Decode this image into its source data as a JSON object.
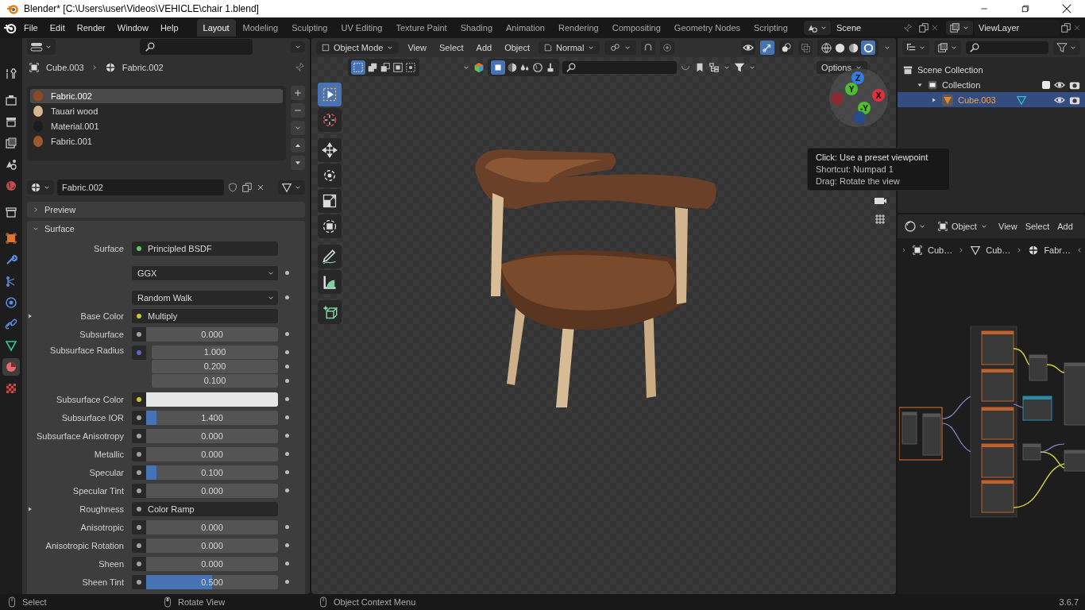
{
  "window": {
    "title": "Blender* [C:\\Users\\user\\Videos\\VEHICLE\\chair 1.blend]"
  },
  "menu": [
    "File",
    "Edit",
    "Render",
    "Window",
    "Help"
  ],
  "workspaces": [
    {
      "label": "Layout",
      "selected": true
    },
    {
      "label": "Modeling",
      "selected": false
    },
    {
      "label": "Sculpting",
      "selected": false
    },
    {
      "label": "UV Editing",
      "selected": false
    },
    {
      "label": "Texture Paint",
      "selected": false
    },
    {
      "label": "Shading",
      "selected": false
    },
    {
      "label": "Animation",
      "selected": false
    },
    {
      "label": "Rendering",
      "selected": false
    },
    {
      "label": "Compositing",
      "selected": false
    },
    {
      "label": "Geometry Nodes",
      "selected": false
    },
    {
      "label": "Scripting",
      "selected": false
    }
  ],
  "scene": "Scene",
  "view_layer": "ViewLayer",
  "properties": {
    "tabs": [
      {
        "kind": "tool",
        "selected": false
      },
      {
        "kind": "render",
        "selected": false
      },
      {
        "kind": "output",
        "selected": false
      },
      {
        "kind": "view-layer",
        "selected": false
      },
      {
        "kind": "scene",
        "selected": false
      },
      {
        "kind": "world",
        "selected": false
      },
      {
        "kind": "collection",
        "selected": false
      },
      {
        "kind": "object",
        "selected": false
      },
      {
        "kind": "modifier",
        "selected": false
      },
      {
        "kind": "particles",
        "selected": false
      },
      {
        "kind": "physics",
        "selected": false
      },
      {
        "kind": "constraints",
        "selected": false
      },
      {
        "kind": "data",
        "selected": false
      },
      {
        "kind": "material",
        "selected": true
      },
      {
        "kind": "texture",
        "selected": false
      }
    ],
    "breadcrumb": [
      "Cube.003",
      "Fabric.002"
    ],
    "material_slots": [
      {
        "name": "Fabric.002",
        "color": "#8a4a24",
        "selected": true
      },
      {
        "name": "Tauari wood",
        "color": "#d8b88e",
        "selected": false
      },
      {
        "name": "Material.001",
        "color": "#1c1c1c",
        "selected": false
      },
      {
        "name": "Fabric.001",
        "color": "#9a5a2a",
        "selected": false
      }
    ],
    "material_name": "Fabric.002",
    "panels": [
      {
        "title": "Preview",
        "expanded": false
      },
      {
        "title": "Surface",
        "expanded": true
      }
    ],
    "rows": [
      {
        "kind": "link",
        "label": "Surface",
        "color": "#63c763",
        "value": "Principled BSDF",
        "expander": false
      },
      {
        "kind": "dropdown",
        "value": "GGX"
      },
      {
        "kind": "dropdown",
        "value": "Random Walk"
      },
      {
        "kind": "link",
        "label": "Base Color",
        "color": "#c7c729",
        "value": "Multiply",
        "expander": true
      },
      {
        "kind": "slider",
        "label": "Subsurface",
        "color": "#a1a1a1",
        "value": "0.000",
        "level": 0
      },
      {
        "kind": "vector",
        "label": "Subsurface Radius",
        "color": "#6363c7",
        "values": [
          "1.000",
          "0.200",
          "0.100"
        ]
      },
      {
        "kind": "swatch",
        "label": "Subsurface Color",
        "color": "#c7c729",
        "swatch": {
          "color": "#e6e6e6"
        }
      },
      {
        "kind": "slider",
        "label": "Subsurface IOR",
        "color": "#a1a1a1",
        "value": "1.400",
        "level": 0.08
      },
      {
        "kind": "slider",
        "label": "Subsurface Anisotropy",
        "color": "#a1a1a1",
        "value": "0.000",
        "level": 0
      },
      {
        "kind": "slider",
        "label": "Metallic",
        "color": "#a1a1a1",
        "value": "0.000",
        "level": 0
      },
      {
        "kind": "slider",
        "label": "Specular",
        "color": "#a1a1a1",
        "value": "0.100",
        "level": 0.08
      },
      {
        "kind": "slider",
        "label": "Specular Tint",
        "color": "#a1a1a1",
        "value": "0.000",
        "level": 0
      },
      {
        "kind": "link",
        "label": "Roughness",
        "color": "#a1a1a1",
        "value": "Color Ramp",
        "expander": true
      },
      {
        "kind": "slider",
        "label": "Anisotropic",
        "color": "#a1a1a1",
        "value": "0.000",
        "level": 0
      },
      {
        "kind": "slider",
        "label": "Anisotropic Rotation",
        "color": "#a1a1a1",
        "value": "0.000",
        "level": 0
      },
      {
        "kind": "slider",
        "label": "Sheen",
        "color": "#a1a1a1",
        "value": "0.000",
        "level": 0
      },
      {
        "kind": "slider",
        "label": "Sheen Tint",
        "color": "#a1a1a1",
        "value": "0.500",
        "level": 0.5
      }
    ]
  },
  "viewport": {
    "mode": "Object Mode",
    "menus": [
      "View",
      "Select",
      "Add",
      "Object"
    ],
    "orientation": "Normal",
    "options": "Options",
    "tools": [
      {
        "kind": "select",
        "selected": true
      },
      {
        "kind": "cursor",
        "selected": false
      },
      {
        "kind": "move",
        "selected": false
      },
      {
        "kind": "rotate",
        "selected": false
      },
      {
        "kind": "scale",
        "selected": false
      },
      {
        "kind": "transform",
        "selected": false
      },
      {
        "kind": "annotate",
        "selected": false
      },
      {
        "kind": "measure",
        "selected": false
      },
      {
        "kind": "add-cube",
        "selected": false
      }
    ],
    "gizmo_axes": [
      "Z",
      "Y",
      "X",
      "-Y"
    ],
    "tooltip": [
      "Click: Use a preset viewpoint",
      "Shortcut: Numpad 1",
      "Drag: Rotate the view"
    ]
  },
  "outliner": {
    "tree": [
      {
        "label": "Scene Collection",
        "selected": false,
        "children": [
          {
            "label": "Collection",
            "selected": false,
            "expanded": true,
            "children": [
              {
                "label": "Cube.003",
                "selected": true,
                "expanded": false
              }
            ]
          }
        ]
      }
    ]
  },
  "node_editor": {
    "mode": "Object",
    "menus": [
      "View",
      "Select",
      "Add"
    ],
    "breadcrumb": [
      "Cub…",
      "Cub…",
      "Fabr…"
    ]
  },
  "status_bar": [
    {
      "label": "Select"
    },
    {
      "label": "Rotate View"
    },
    {
      "label": "Object Context Menu"
    }
  ],
  "version": "3.6.7"
}
